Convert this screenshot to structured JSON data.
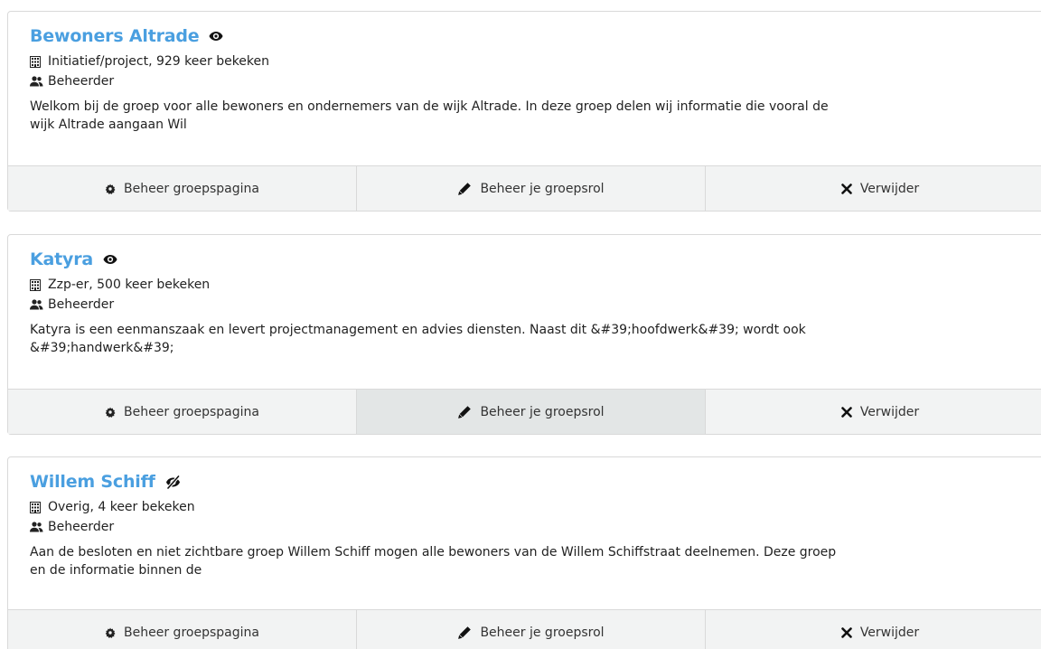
{
  "groups": [
    {
      "title": "Bewoners Altrade",
      "visibility_icon": "eye-icon",
      "meta": "Initiatief/project, 929 keer bekeken",
      "role": "Beheerder",
      "description_line1": "Welkom bij de groep voor alle bewoners en ondernemers van de wijk Altrade. In deze groep delen wij informatie die vooral de",
      "description_line2": "wijk Altrade aangaan Wil",
      "manage_page_label": "Beheer groepspagina",
      "manage_role_label": "Beheer je groepsrol",
      "delete_label": "Verwijder"
    },
    {
      "title": "Katyra",
      "visibility_icon": "eye-icon",
      "meta": "Zzp-er, 500 keer bekeken",
      "role": "Beheerder",
      "description_line1": "Katyra is een eenmanszaak en levert projectmanagement en advies diensten. Naast dit &#39;hoofdwerk&#39; wordt ook",
      "description_line2": "&#39;handwerk&#39;",
      "manage_page_label": "Beheer groepspagina",
      "manage_role_label": "Beheer je groepsrol",
      "delete_label": "Verwijder"
    },
    {
      "title": "Willem Schiff",
      "visibility_icon": "eye-slash-icon",
      "meta": "Overig, 4 keer bekeken",
      "role": "Beheerder",
      "description_line1": "Aan de besloten en niet zichtbare groep Willem Schiff mogen alle bewoners van de Willem Schiffstraat deelnemen. Deze groep",
      "description_line2": "en de informatie binnen de",
      "manage_page_label": "Beheer groepspagina",
      "manage_role_label": "Beheer je groepsrol",
      "delete_label": "Verwijder"
    }
  ],
  "hovered_action": "groups.1.manage_role",
  "colors": {
    "title": "#4a9fe0",
    "action_bar": "#f2f3f3",
    "action_hover": "#e3e6e6",
    "border": "#d9d9d9"
  }
}
